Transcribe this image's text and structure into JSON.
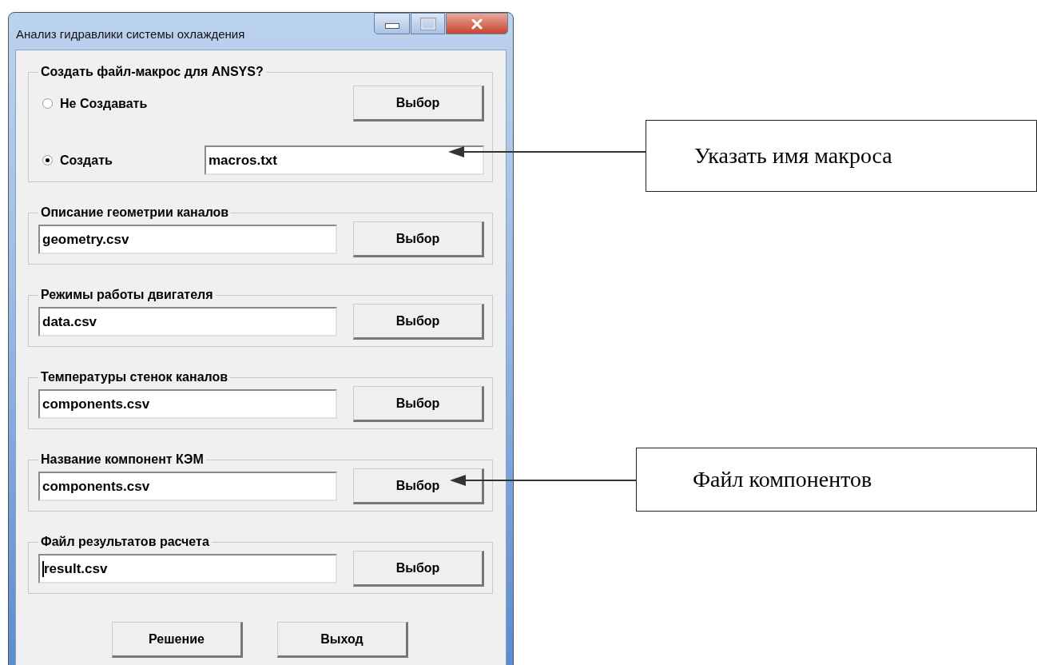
{
  "window": {
    "title": "Анализ гидравлики системы охлаждения"
  },
  "macro_group": {
    "legend": "Создать файл-макрос для ANSYS?",
    "options": [
      {
        "label": "Не Создавать",
        "selected": false
      },
      {
        "label": "Создать",
        "selected": true
      }
    ],
    "button": "Выбор",
    "value": "macros.txt"
  },
  "file_groups": [
    {
      "legend": "Описание геометрии каналов",
      "value": "geometry.csv",
      "button": "Выбор",
      "focused": false
    },
    {
      "legend": "Режимы работы двигателя",
      "value": "data.csv",
      "button": "Выбор",
      "focused": false
    },
    {
      "legend": "Температуры стенок каналов",
      "value": "components.csv",
      "button": "Выбор",
      "focused": false
    },
    {
      "legend": "Название компонент КЭМ",
      "value": "components.csv",
      "button": "Выбор",
      "focused": false
    },
    {
      "legend": "Файл результатов расчета",
      "value": "result.csv",
      "button": "Выбор",
      "focused": true
    }
  ],
  "buttons": [
    "Решение",
    "Выход"
  ],
  "annotations": [
    {
      "text": "Указать имя макроса"
    },
    {
      "text": "Файл компонентов"
    }
  ]
}
